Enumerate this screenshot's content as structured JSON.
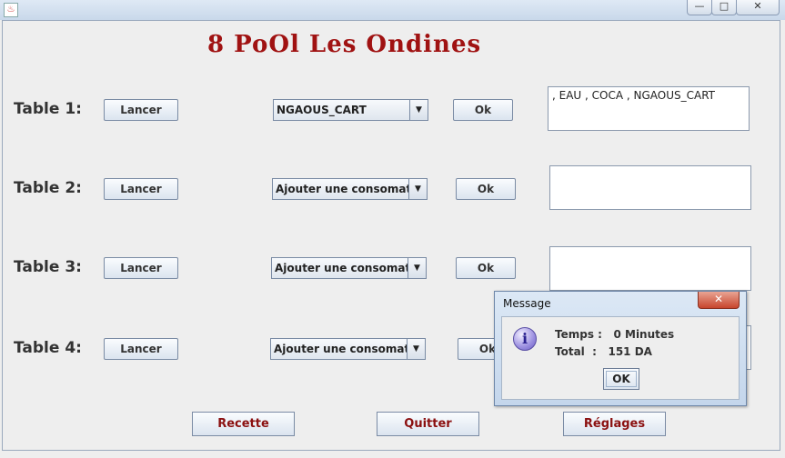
{
  "window": {
    "minimize_glyph": "—",
    "maximize_glyph": "□",
    "close_glyph": "✕",
    "app_icon": "java-cup-icon"
  },
  "title": "8 PoOl Les Ondines",
  "tables": [
    {
      "label": "Table 1:",
      "launch": "Lancer",
      "combo": "NGAOUS_CART",
      "ok": "Ok",
      "consumptions": ", EAU , COCA , NGAOUS_CART"
    },
    {
      "label": "Table 2:",
      "launch": "Lancer",
      "combo": "Ajouter une consomation",
      "ok": "Ok",
      "consumptions": ""
    },
    {
      "label": "Table 3:",
      "launch": "Lancer",
      "combo": "Ajouter une consomation",
      "ok": "Ok",
      "consumptions": ""
    },
    {
      "label": "Table 4:",
      "launch": "Lancer",
      "combo": "Ajouter une consomation",
      "ok": "Ok",
      "consumptions": ""
    }
  ],
  "bottom": {
    "recette": "Recette",
    "quitter": "Quitter",
    "reglages": "Réglages"
  },
  "dialog": {
    "title": "Message",
    "close_glyph": "✕",
    "icon": "info-icon",
    "line1": "Temps :   0 Minutes",
    "line2": "Total  :   151 DA",
    "ok": "OK"
  },
  "colors": {
    "title": "#a01212",
    "bottom_button_text": "#8b1010"
  }
}
